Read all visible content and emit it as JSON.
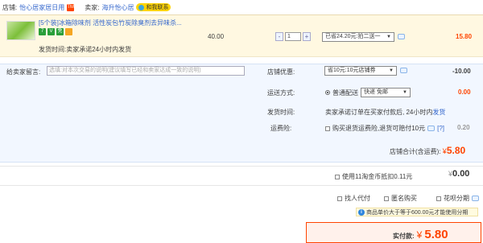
{
  "shop": {
    "shop_label": "店铺:",
    "shop_name": "怡心居家居日用",
    "tmall_badge": "TM",
    "seller_label": "卖家:",
    "seller_name": "海升怡心居",
    "contact_label": "和我联系"
  },
  "item": {
    "title": "[5个装]冰箱除味剂 活性炭包竹炭除臭剂去异味杀...",
    "badges": [
      "7",
      "V",
      "免"
    ],
    "ship_note": "发货时间:卖家承诺24小时内发货",
    "price": "40.00",
    "quantity": "1",
    "minus": "-",
    "plus": "+",
    "discount": "已省24.20元:拍二送一",
    "subtotal": "15.80"
  },
  "form": {
    "message_label": "给卖家留言:",
    "message_placeholder": "选填:对本次交易的说明(建议填写已经和卖家达成一致的说明)",
    "coupon_label": "店铺优惠:",
    "coupon_value": "省10元:10元店铺券",
    "coupon_amount": "-10.00",
    "delivery_label": "运送方式:",
    "delivery_mode": "普通配送",
    "delivery_select": "快递 免邮",
    "delivery_amount": "0.00",
    "dispatch_label": "发货时间:",
    "dispatch_text": "卖家承诺订单在买家付款后, 24小时内",
    "dispatch_link": "发货",
    "insurance_label": "运费险:",
    "insurance_text": "购买退货运费险,退货可赔付10元",
    "insurance_help": "[?]",
    "insurance_amount": "0.20",
    "shop_total_label": "店铺合计(含运费):",
    "shop_total_currency": "¥",
    "shop_total": "5.80"
  },
  "coins": {
    "label": "使用11淘金币抵扣0.11元",
    "currency": "¥",
    "amount": "0.00"
  },
  "options": {
    "proxy_pay": "找人代付",
    "anonymous": "匿名购买",
    "installment": "花呗分期"
  },
  "info": {
    "text": "商品单价大于等于600.00元才能使用分期",
    "icon": "i"
  },
  "pay": {
    "label": "实付款:",
    "currency": "¥",
    "amount": "5.80"
  }
}
